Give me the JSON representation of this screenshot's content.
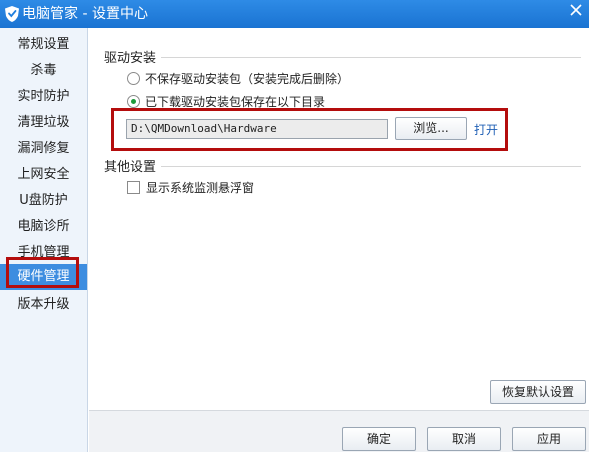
{
  "window": {
    "title": "电脑管家 - 设置中心"
  },
  "sidebar": {
    "items": [
      {
        "label": "常规设置"
      },
      {
        "label": "杀毒"
      },
      {
        "label": "实时防护"
      },
      {
        "label": "清理垃圾"
      },
      {
        "label": "漏洞修复"
      },
      {
        "label": "上网安全"
      },
      {
        "label": "U盘防护"
      },
      {
        "label": "电脑诊所"
      },
      {
        "label": "手机管理"
      },
      {
        "label": "硬件管理"
      },
      {
        "label": "版本升级"
      }
    ],
    "active_index": 9
  },
  "driver_section": {
    "title": "驱动安装",
    "options": [
      {
        "label": "不保存驱动安装包（安装完成后删除）",
        "checked": false
      },
      {
        "label": "已下载驱动安装包保存在以下目录",
        "checked": true
      }
    ],
    "path_value": "D:\\QMDownload\\Hardware",
    "browse_label": "浏览...",
    "open_label": "打开"
  },
  "other_section": {
    "title": "其他设置",
    "options": [
      {
        "label": "显示系统监测悬浮窗",
        "checked": false
      }
    ]
  },
  "restore_label": "恢复默认设置",
  "footer": {
    "ok_label": "确定",
    "cancel_label": "取消",
    "apply_label": "应用"
  },
  "colors": {
    "title_bar": "#1f7fde",
    "sidebar_active": "#3d8de0",
    "highlight_border": "#b40d0d",
    "radio_selected": "#1c9a3a",
    "link": "#1f5fb5"
  },
  "icons": {
    "app_logo": "shield-logo-icon",
    "close": "close-icon"
  }
}
